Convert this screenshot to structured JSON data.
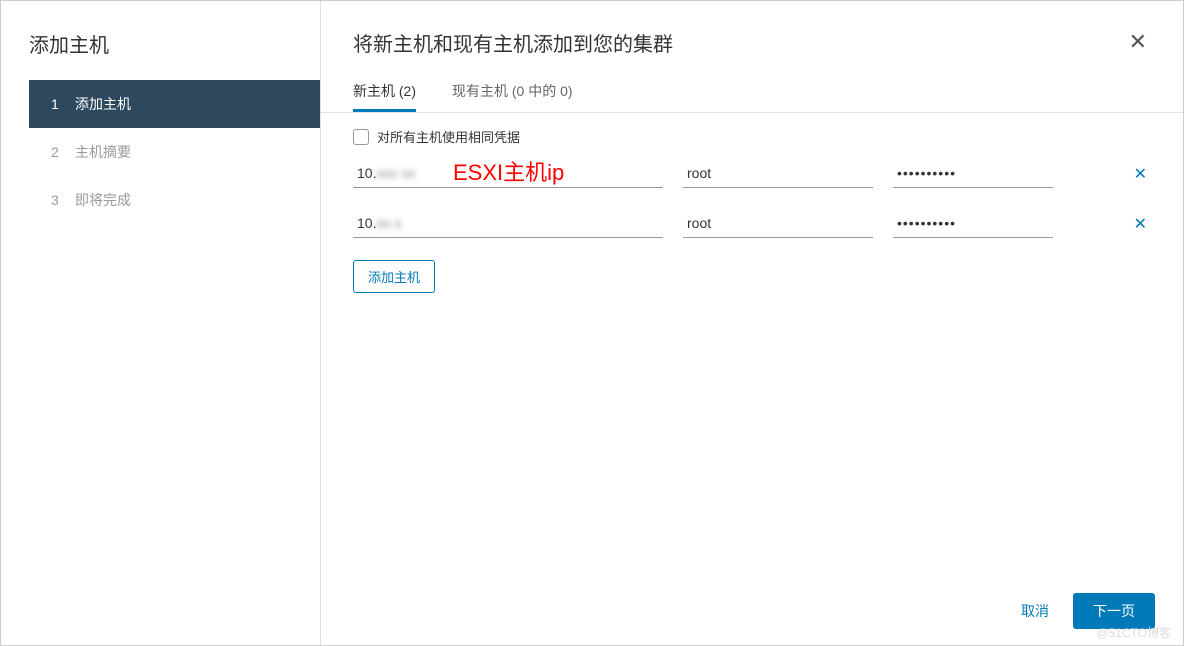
{
  "sidebar": {
    "title": "添加主机",
    "steps": [
      {
        "num": "1",
        "label": "添加主机",
        "active": true
      },
      {
        "num": "2",
        "label": "主机摘要",
        "active": false
      },
      {
        "num": "3",
        "label": "即将完成",
        "active": false
      }
    ]
  },
  "main": {
    "title": "将新主机和现有主机添加到您的集群",
    "tabs": [
      {
        "label": "新主机 (2)",
        "active": true
      },
      {
        "label": "现有主机 (0 中的 0)",
        "active": false
      }
    ],
    "checkbox_label": "对所有主机使用相同凭据",
    "rows": [
      {
        "ip_prefix": "10.",
        "ip_blur": "xxx xx",
        "user": "root",
        "pass": "••••••••••"
      },
      {
        "ip_prefix": "10.",
        "ip_blur": "xx  x",
        "user": "root",
        "pass": "••••••••••"
      }
    ],
    "add_host_label": "添加主机",
    "annotation": "ESXI主机ip"
  },
  "footer": {
    "cancel": "取消",
    "next": "下一页"
  },
  "watermark": "@51CTO博客"
}
